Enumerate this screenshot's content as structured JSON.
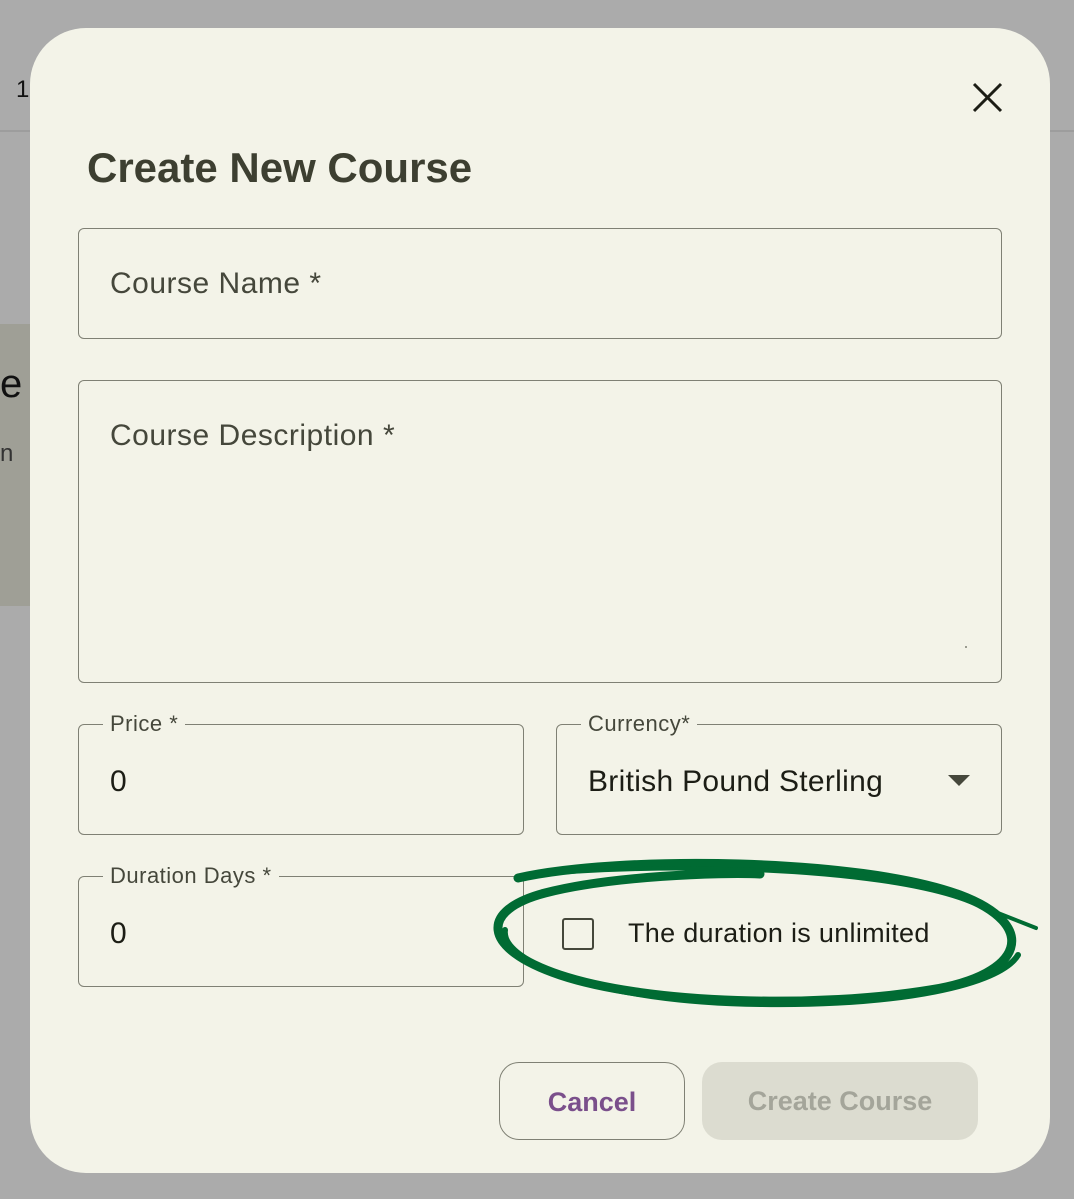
{
  "background": {
    "top_number": "1",
    "card_letter": "e",
    "card_sub_letter": "n"
  },
  "dialog": {
    "title": "Create New Course",
    "close_icon": "close-icon",
    "course_name": {
      "placeholder": "Course Name *",
      "value": ""
    },
    "course_description": {
      "placeholder": "Course Description *",
      "value": ""
    },
    "price": {
      "label": "Price *",
      "value": "0"
    },
    "currency": {
      "label": "Currency*",
      "selected": "British Pound Sterling"
    },
    "duration_days": {
      "label": "Duration Days *",
      "value": "0"
    },
    "unlimited_checkbox": {
      "label": "The duration is unlimited",
      "checked": false
    },
    "buttons": {
      "cancel": "Cancel",
      "create": "Create Course"
    }
  },
  "colors": {
    "dialog_bg": "#f3f3e8",
    "accent_text": "#7a4f8b",
    "annotation": "#006b33",
    "disabled_button": "#dcdcd0"
  }
}
